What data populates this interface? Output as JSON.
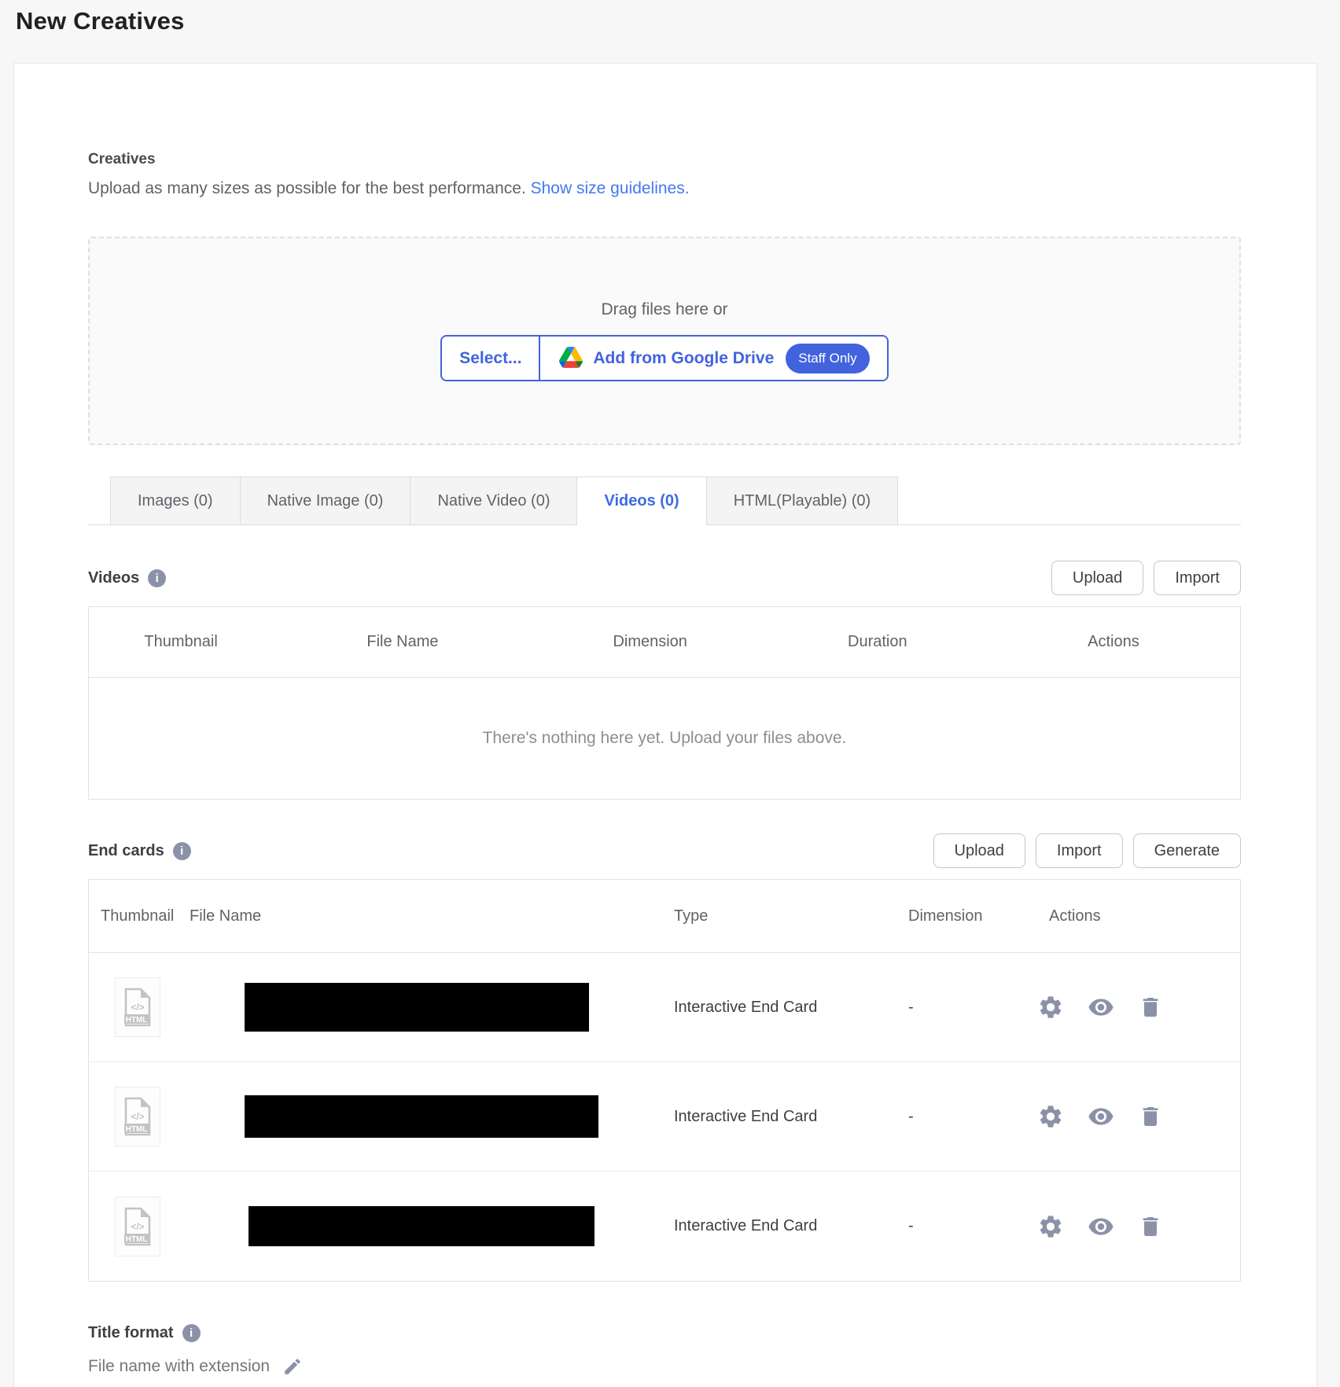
{
  "page": {
    "title": "New Creatives"
  },
  "creatives": {
    "label": "Creatives",
    "description": "Upload as many sizes as possible for the best performance. ",
    "guidelines_link": "Show size guidelines.",
    "dropzone": {
      "drag_text": "Drag files here or",
      "select_button": "Select...",
      "drive_button": "Add from Google Drive",
      "staff_badge": "Staff Only"
    }
  },
  "tabs": [
    {
      "label": "Images (0)",
      "active": false
    },
    {
      "label": "Native Image (0)",
      "active": false
    },
    {
      "label": "Native Video (0)",
      "active": false
    },
    {
      "label": "Videos (0)",
      "active": true
    },
    {
      "label": "HTML(Playable) (0)",
      "active": false
    }
  ],
  "videos": {
    "title": "Videos",
    "upload_button": "Upload",
    "import_button": "Import",
    "columns": [
      "Thumbnail",
      "File Name",
      "Dimension",
      "Duration",
      "Actions"
    ],
    "empty_text": "There's nothing here yet. Upload your files above."
  },
  "end_cards": {
    "title": "End cards",
    "upload_button": "Upload",
    "import_button": "Import",
    "generate_button": "Generate",
    "columns": [
      "Thumbnail",
      "File Name",
      "Type",
      "Dimension",
      "Actions"
    ],
    "rows": [
      {
        "file_type": "HTML",
        "type": "Interactive End Card",
        "dimension": "-"
      },
      {
        "file_type": "HTML",
        "type": "Interactive End Card",
        "dimension": "-"
      },
      {
        "file_type": "HTML",
        "type": "Interactive End Card",
        "dimension": "-"
      }
    ]
  },
  "title_format": {
    "label": "Title format",
    "value": "File name with extension"
  },
  "icons": {
    "info_glyph": "i",
    "html_file_glyph": "</>"
  },
  "colors": {
    "accent_blue": "#4263dd",
    "link_blue": "#4478f0",
    "tab_active_blue": "#3e6be0",
    "icon_gray": "#8b92a8"
  }
}
